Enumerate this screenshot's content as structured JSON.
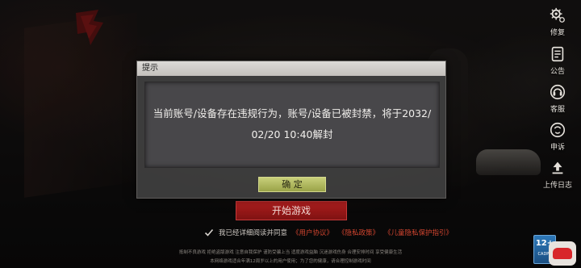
{
  "side_menu": [
    {
      "label": "修复",
      "icon": "gear-icon"
    },
    {
      "label": "公告",
      "icon": "notice-icon"
    },
    {
      "label": "客服",
      "icon": "headset-icon"
    },
    {
      "label": "申诉",
      "icon": "appeal-icon"
    },
    {
      "label": "上传日志",
      "icon": "upload-icon"
    }
  ],
  "start_button_label": "开始游戏",
  "agreement": {
    "text": "我已经详细阅读并同意",
    "links": [
      "《用户协议》",
      "《隐私政策》",
      "《儿童隐私保护指引》"
    ]
  },
  "footer": {
    "line1": "抵制不良游戏 拒绝盗版游戏 注意自我保护 谨防受骗上当 适度游戏益脑 沉迷游戏伤身 合理安排时间 享受健康生活",
    "line2": "本网络游戏适合年满12周岁以上的用户使用；为了您的健康，请合理控制游戏时间"
  },
  "age_badge": {
    "value": "12+",
    "sub": "CADPA"
  },
  "modal": {
    "title": "提示",
    "message": "当前账号/设备存在违规行为，账号/设备已被封禁，将于2032/02/20 10:40解封",
    "confirm_label": "确 定"
  },
  "colors": {
    "accent_red": "#b01f1f",
    "link_red": "#d2452f",
    "confirm_green": "#b4bc5f"
  }
}
